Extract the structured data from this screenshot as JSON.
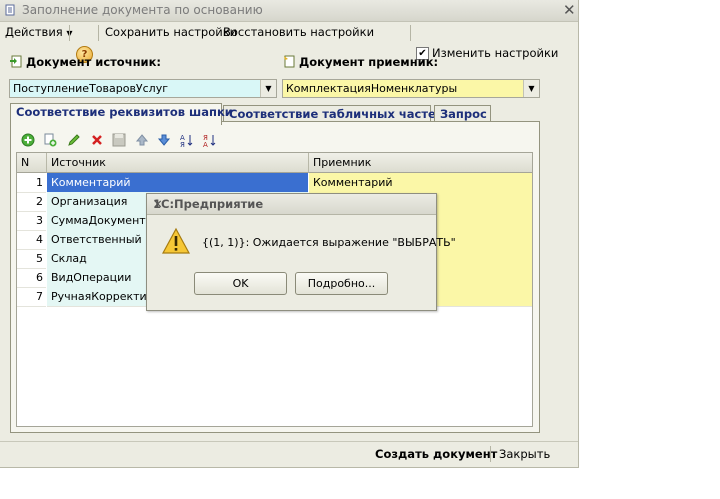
{
  "window": {
    "title": "Заполнение документа по основанию",
    "colors": {
      "background": "#ecece2",
      "accent": "#1d2f7a"
    }
  },
  "toolbar": {
    "actions_label": "Действия",
    "help_label": "?",
    "save_settings_label": "Сохранить настройки",
    "restore_settings_label": "Восстановить настройки",
    "change_settings_label": "Изменить настройки",
    "change_settings_checked": true
  },
  "source": {
    "label": "Документ источник:",
    "value": "ПоступлениеТоваровУслуг",
    "field_color": "#d9f7f7"
  },
  "target": {
    "label": "Документ приемник:",
    "value": "КомплектацияНоменклатуры",
    "field_color": "#fbf7a7"
  },
  "tabs": [
    {
      "label": "Соответствие реквизитов шапки",
      "active": true
    },
    {
      "label": "Соответствие табличных частей",
      "active": false
    },
    {
      "label": "Запрос",
      "active": false
    }
  ],
  "grid": {
    "columns": [
      "N",
      "Источник",
      "Приемник"
    ],
    "rows": [
      {
        "n": "1",
        "source": "Комментарий",
        "target": "Комментарий",
        "selected": true
      },
      {
        "n": "2",
        "source": "Организация",
        "target": ""
      },
      {
        "n": "3",
        "source": "СуммаДокумента",
        "target": ""
      },
      {
        "n": "4",
        "source": "Ответственный",
        "target": ""
      },
      {
        "n": "5",
        "source": "Склад",
        "target": ""
      },
      {
        "n": "6",
        "source": "ВидОперации",
        "target": ""
      },
      {
        "n": "7",
        "source": "РучнаяКорректировка",
        "target": ""
      }
    ]
  },
  "dialog": {
    "title": "1С:Предприятие",
    "message": "{(1, 1)}: Ожидается выражение \"ВЫБРАТЬ\"",
    "ok_label": "OK",
    "details_label": "Подробно..."
  },
  "footer": {
    "create_label": "Создать документ",
    "close_label": "Закрыть"
  }
}
